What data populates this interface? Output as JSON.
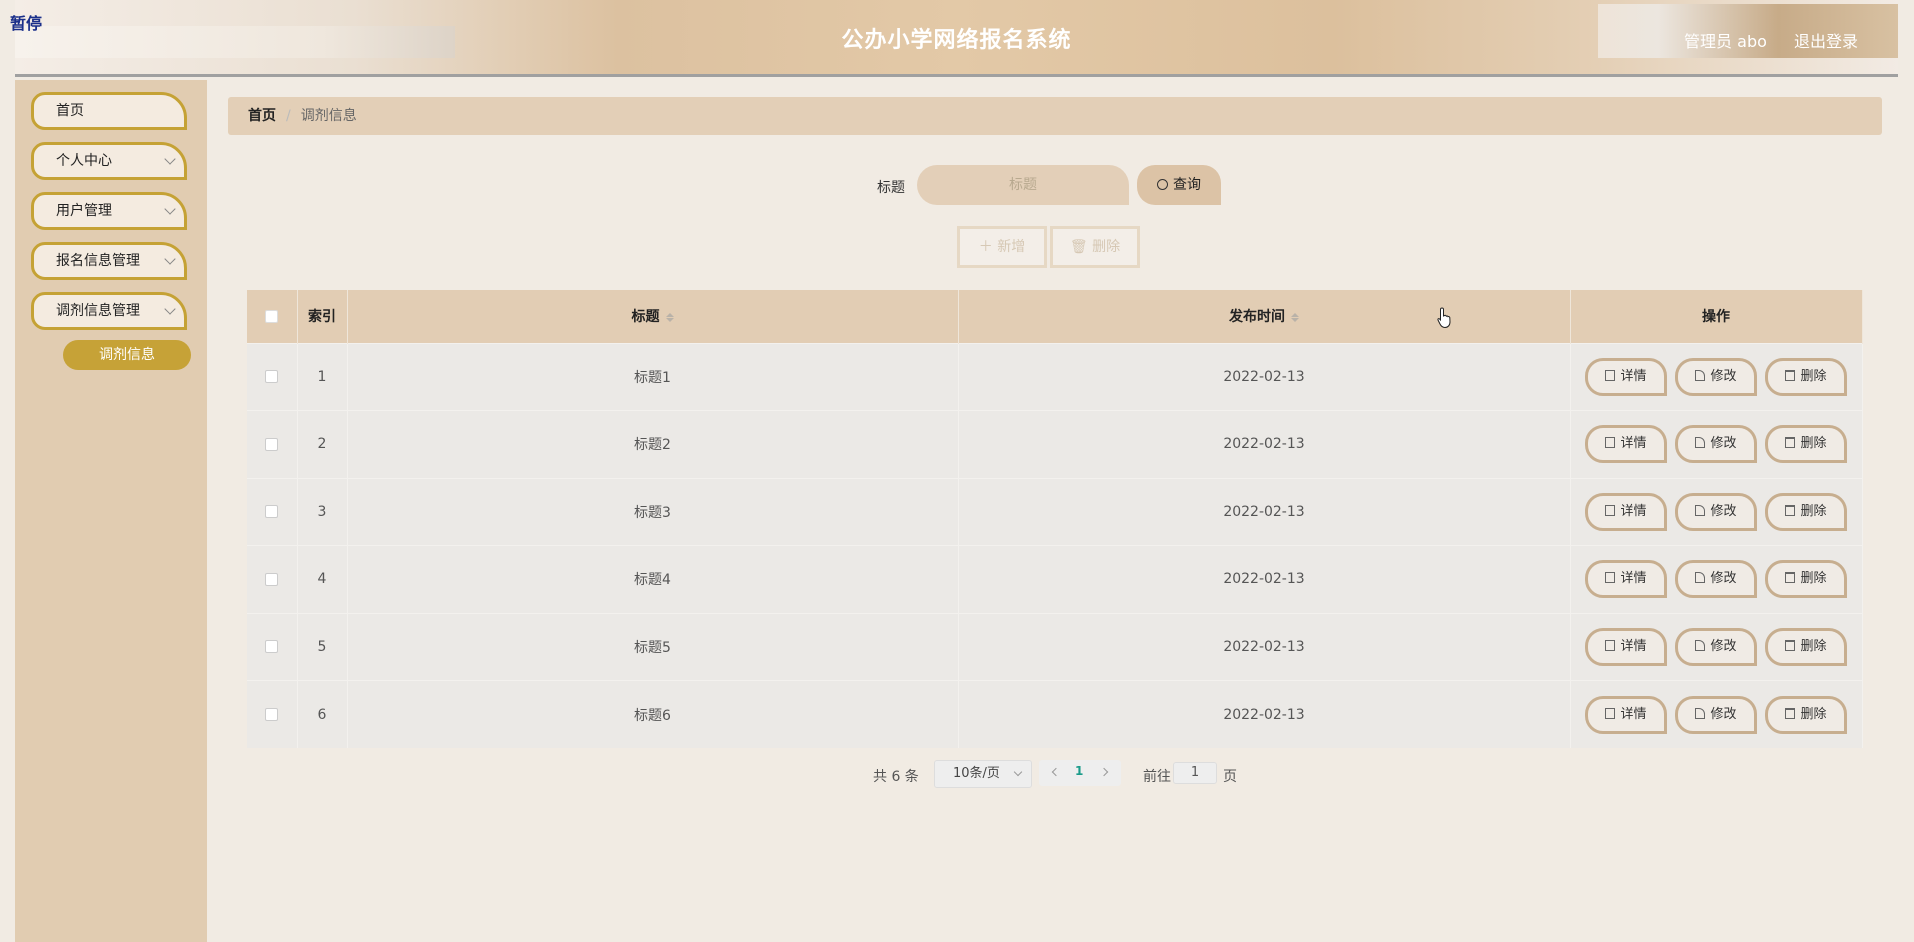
{
  "overlay": {
    "paused_label": "暂停"
  },
  "header": {
    "title": "公办小学网络报名系统",
    "user_label": "管理员 abo",
    "logout_label": "退出登录"
  },
  "sidebar": {
    "items": [
      {
        "label": "首页",
        "has_submenu": false
      },
      {
        "label": "个人中心",
        "has_submenu": true
      },
      {
        "label": "用户管理",
        "has_submenu": true
      },
      {
        "label": "报名信息管理",
        "has_submenu": true
      },
      {
        "label": "调剂信息管理",
        "has_submenu": true
      }
    ],
    "active_sub_item": "调剂信息"
  },
  "breadcrumb": {
    "home": "首页",
    "separator": "/",
    "current": "调剂信息"
  },
  "search": {
    "label": "标题",
    "placeholder": "标题",
    "button_label": "查询"
  },
  "actions": {
    "add_label": "新增",
    "delete_label": "删除"
  },
  "table": {
    "headers": {
      "index": "索引",
      "title": "标题",
      "publish_time": "发布时间",
      "ops": "操作"
    },
    "rows": [
      {
        "index": "1",
        "title": "标题1",
        "publish_time": "2022-02-13"
      },
      {
        "index": "2",
        "title": "标题2",
        "publish_time": "2022-02-13"
      },
      {
        "index": "3",
        "title": "标题3",
        "publish_time": "2022-02-13"
      },
      {
        "index": "4",
        "title": "标题4",
        "publish_time": "2022-02-13"
      },
      {
        "index": "5",
        "title": "标题5",
        "publish_time": "2022-02-13"
      },
      {
        "index": "6",
        "title": "标题6",
        "publish_time": "2022-02-13"
      }
    ],
    "row_actions": {
      "detail": "详情",
      "edit": "修改",
      "delete": "删除"
    }
  },
  "pagination": {
    "total_label": "共 6 条",
    "page_size": "10条/页",
    "current_page": "1",
    "goto_label": "前往",
    "goto_value": "1",
    "page_unit": "页"
  },
  "colors": {
    "accent": "#c6a237",
    "header_bg": "#e2cdb4",
    "sidebar_bg": "#e1ccb1"
  }
}
